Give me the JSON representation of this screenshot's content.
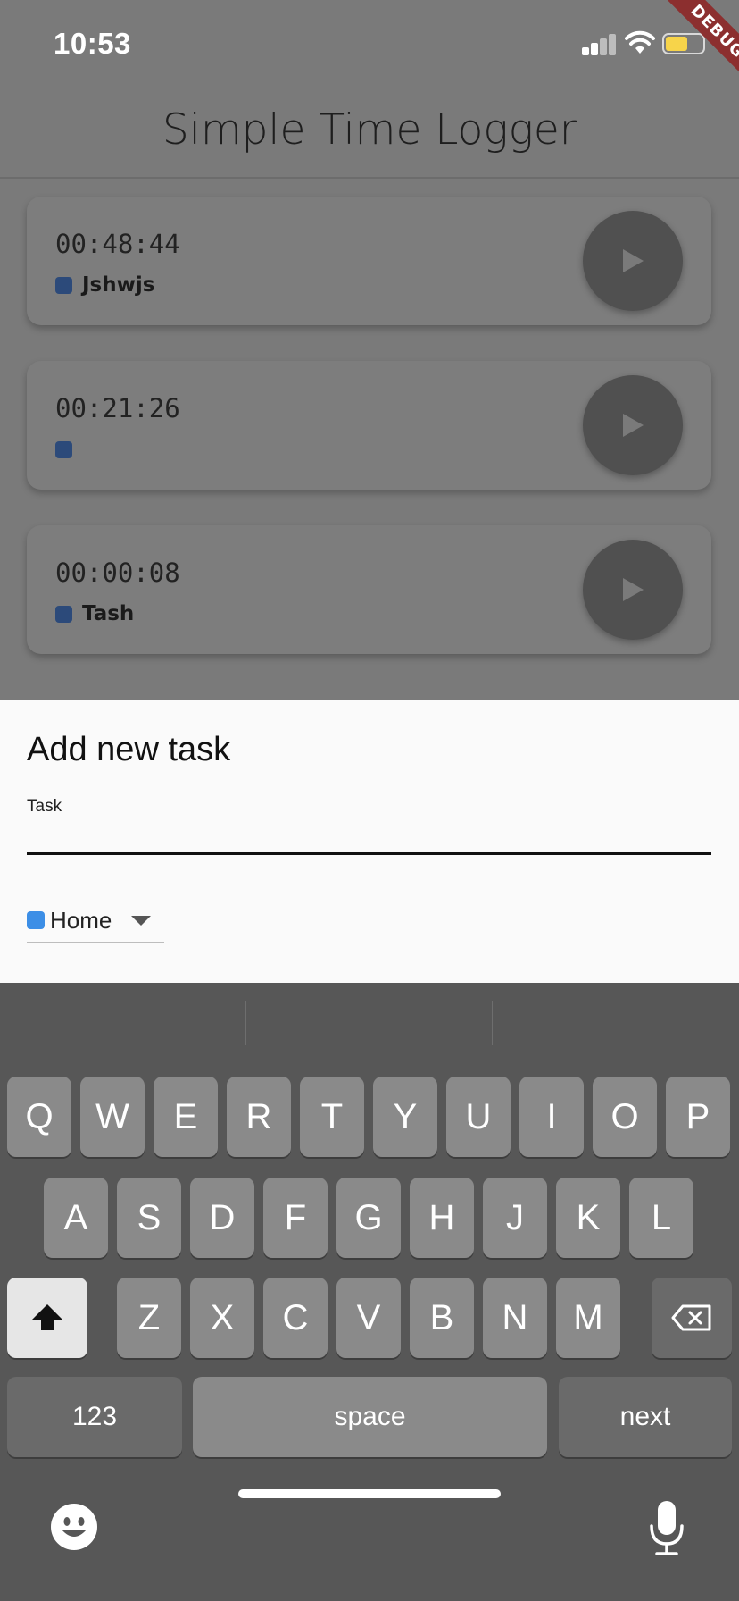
{
  "status_bar": {
    "time": "10:53",
    "signal_icon": "cellular-signal-icon",
    "wifi_icon": "wifi-icon",
    "battery_icon": "battery-icon",
    "battery_color": "#f7d44a"
  },
  "debug_banner": {
    "label": "DEBUG",
    "color": "#8c2f2f"
  },
  "app_bar": {
    "title": "Simple Time Logger"
  },
  "tasks": [
    {
      "time": "00:48:44",
      "name": "Jshwjs",
      "tag_color": "#2c4a7a",
      "action_icon": "play-icon"
    },
    {
      "time": "00:21:26",
      "name": "",
      "tag_color": "#2c4a7a",
      "action_icon": "play-icon"
    },
    {
      "time": "00:00:08",
      "name": "Tash",
      "tag_color": "#2c4a7a",
      "action_icon": "play-icon"
    }
  ],
  "add_task_sheet": {
    "title": "Add new task",
    "task_field": {
      "label": "Task",
      "value": ""
    },
    "category_dropdown": {
      "selected": "Home",
      "color": "#3c8ee6",
      "icon": "chevron-down-icon"
    }
  },
  "keyboard": {
    "row1": [
      "Q",
      "W",
      "E",
      "R",
      "T",
      "Y",
      "U",
      "I",
      "O",
      "P"
    ],
    "row2": [
      "A",
      "S",
      "D",
      "F",
      "G",
      "H",
      "J",
      "K",
      "L"
    ],
    "row3": [
      "Z",
      "X",
      "C",
      "V",
      "B",
      "N",
      "M"
    ],
    "shift_icon": "shift-icon",
    "backspace_icon": "backspace-icon",
    "numbers_key": "123",
    "space_key": "space",
    "return_key": "next",
    "emoji_icon": "emoji-icon",
    "mic_icon": "microphone-icon"
  }
}
